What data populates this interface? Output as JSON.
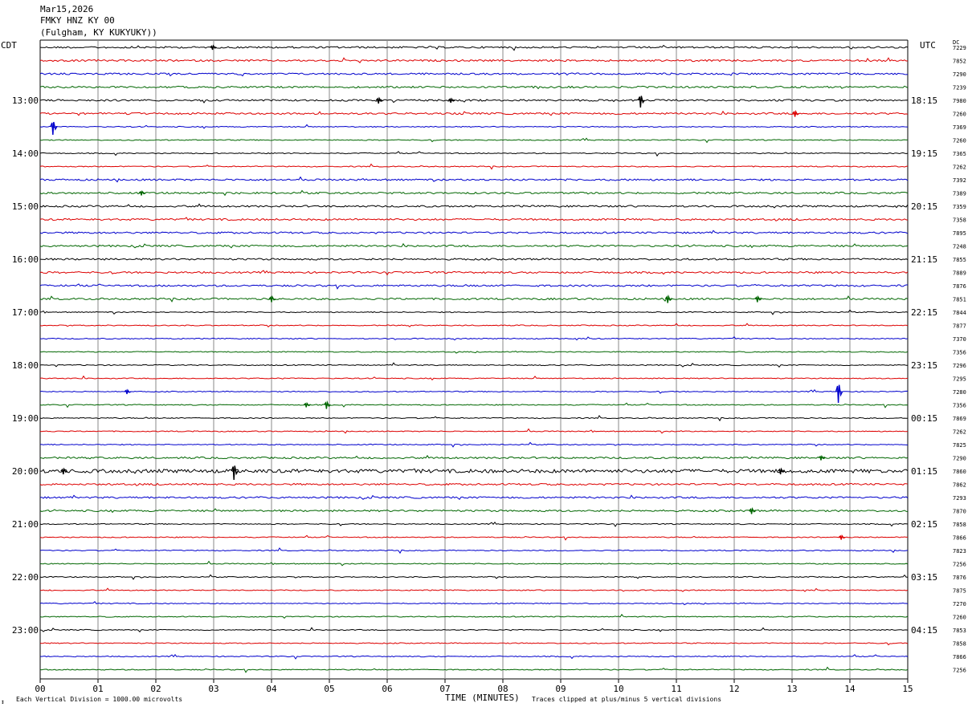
{
  "header": {
    "date": "Mar15,2026",
    "station": "FMKY HNZ KY 00",
    "location": "(Fulgham, KY KUKYUKY))"
  },
  "labels": {
    "left_timezone": "CDT",
    "right_timezone": "UTC",
    "dc": "DC",
    "footer_left": "Each Vertical Division = 1000.00 microvolts",
    "footer_right": "Traces clipped at plus/minus 5 vertical divisions",
    "corner_mark": "↕"
  },
  "chart_data": {
    "type": "line",
    "title": "",
    "xlabel": "TIME (MINUTES)",
    "xlim": [
      0,
      15
    ],
    "x_ticks": [
      "00",
      "01",
      "02",
      "03",
      "04",
      "05",
      "06",
      "07",
      "08",
      "09",
      "10",
      "11",
      "12",
      "13",
      "14",
      "15"
    ],
    "rows_per_hour": 4,
    "trace_colors": [
      "#000000",
      "#dd0000",
      "#0000cc",
      "#006600"
    ],
    "left_hour_labels": [
      "13:00",
      "14:00",
      "15:00",
      "16:00",
      "17:00",
      "18:00",
      "19:00",
      "20:00",
      "21:00",
      "22:00",
      "23:00"
    ],
    "right_hour_labels": [
      "18:15",
      "19:15",
      "20:15",
      "21:15",
      "22:15",
      "23:15",
      "00:15",
      "01:15",
      "02:15",
      "03:15",
      "04:15"
    ],
    "dc_offsets": [
      "7229",
      "7852",
      "7290",
      "7239",
      "7980",
      "7260",
      "7369",
      "7260",
      "7365",
      "7262",
      "7392",
      "7389",
      "7359",
      "7358",
      "7895",
      "7248",
      "7855",
      "7889",
      "7876",
      "7851",
      "7844",
      "7877",
      "7370",
      "7356",
      "7296",
      "7295",
      "7280",
      "7356",
      "7869",
      "7262",
      "7825",
      "7290",
      "7860",
      "7862",
      "7293",
      "7870",
      "7858",
      "7866",
      "7823",
      "7256",
      "7876",
      "7875",
      "7270",
      "7260",
      "7853",
      "7858",
      "7866",
      "7256"
    ],
    "events": [
      {
        "row": 0,
        "minute": 2.98,
        "amp": 3
      },
      {
        "row": 4,
        "minute": 10.38,
        "amp": 9
      },
      {
        "row": 4,
        "minute": 5.85,
        "amp": 4
      },
      {
        "row": 4,
        "minute": 7.1,
        "amp": 3
      },
      {
        "row": 5,
        "minute": 13.05,
        "amp": 4
      },
      {
        "row": 6,
        "minute": 0.22,
        "amp": 10
      },
      {
        "row": 11,
        "minute": 1.75,
        "amp": 3
      },
      {
        "row": 19,
        "minute": 10.85,
        "amp": 5
      },
      {
        "row": 19,
        "minute": 12.4,
        "amp": 4
      },
      {
        "row": 19,
        "minute": 4.0,
        "amp": 4
      },
      {
        "row": 26,
        "minute": 13.8,
        "amp": 14
      },
      {
        "row": 26,
        "minute": 1.5,
        "amp": 3
      },
      {
        "row": 27,
        "minute": 4.95,
        "amp": 5
      },
      {
        "row": 27,
        "minute": 4.6,
        "amp": 3
      },
      {
        "row": 31,
        "minute": 13.5,
        "amp": 3
      },
      {
        "row": 32,
        "minute": 3.35,
        "amp": 11
      },
      {
        "row": 32,
        "minute": 0.4,
        "amp": 4
      },
      {
        "row": 32,
        "minute": 12.8,
        "amp": 4
      },
      {
        "row": 35,
        "minute": 12.3,
        "amp": 4
      },
      {
        "row": 37,
        "minute": 13.85,
        "amp": 3
      }
    ]
  }
}
